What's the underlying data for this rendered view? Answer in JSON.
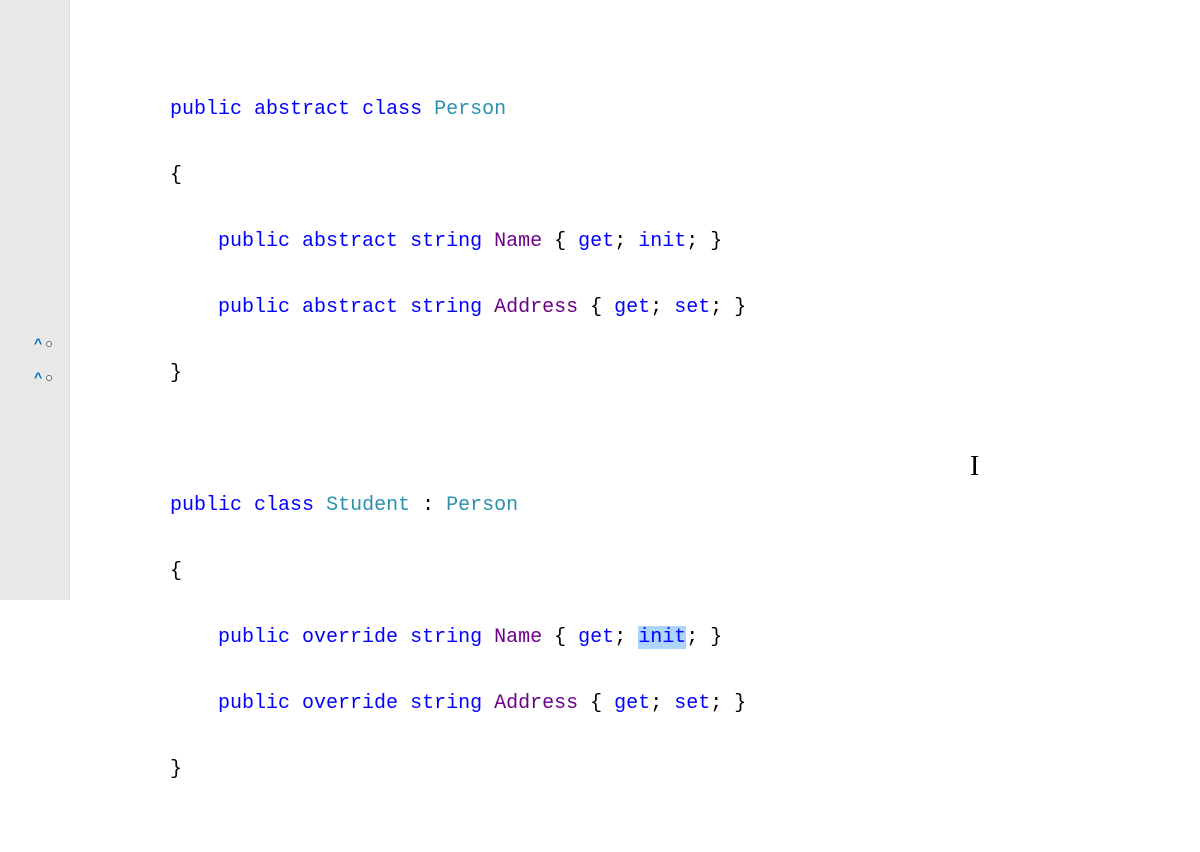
{
  "code": {
    "kw_public": "public",
    "kw_abstract": "abstract",
    "kw_class": "class",
    "kw_override": "override",
    "kw_string": "string",
    "kw_get": "get",
    "kw_set": "set",
    "kw_init": "init",
    "type_person": "Person",
    "type_student": "Student",
    "member_name": "Name",
    "member_address": "Address",
    "brace_open": "{",
    "brace_close": "}",
    "semicolon": ";",
    "colon": ":",
    "space": " "
  },
  "markers": {
    "caret": "^",
    "circle": "o"
  },
  "text_cursor_glyph": "I"
}
